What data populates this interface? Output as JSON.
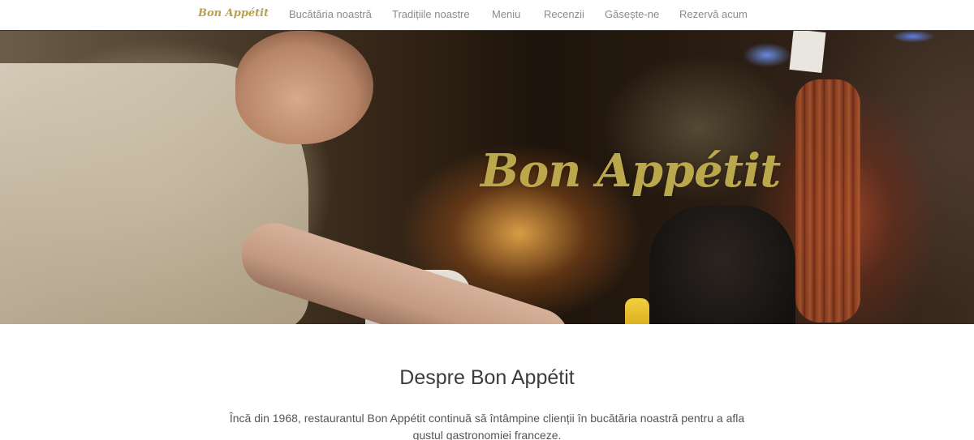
{
  "nav": {
    "brand": "Bon Appétit",
    "links": [
      "Bucătăria noastră",
      "Tradițiile noastre",
      "Meniu",
      "Recenzii",
      "Găsește-ne",
      "Rezervă acum"
    ]
  },
  "hero": {
    "title": "Bon Appétit"
  },
  "about": {
    "heading": "Despre Bon Appétit",
    "text": "Încă din 1968, restaurantul Bon Appétit continuă să întâmpine clienții în bucătăria noastră pentru a afla gustul gastronomiei franceze."
  },
  "colors": {
    "brand_gold": "#b7a14a",
    "hero_title_gold": "#bba84d",
    "nav_link": "#8a8a8a",
    "heading_text": "#3c3c3c",
    "body_text": "#555555"
  }
}
